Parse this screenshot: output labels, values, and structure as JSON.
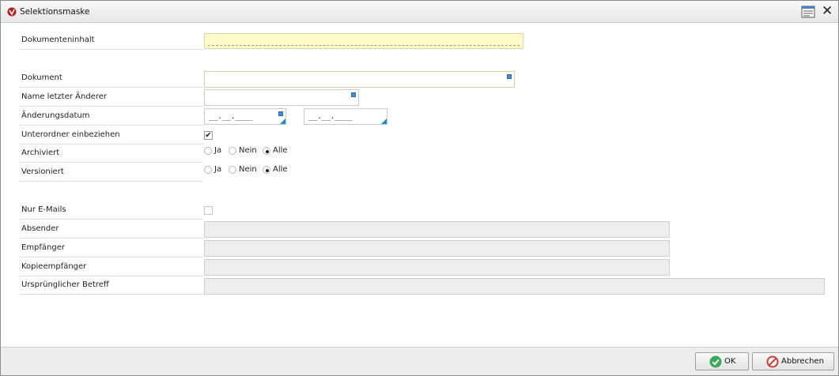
{
  "window": {
    "title": "Selektionsmaske",
    "icons": {
      "app": "app-logo-icon",
      "layout": "layout-settings-icon",
      "close": "close-icon"
    },
    "close_glyph": "✕"
  },
  "form": {
    "dokumenteninhalt": {
      "label": "Dokumenteninhalt",
      "value": ""
    },
    "dokument": {
      "label": "Dokument",
      "value": ""
    },
    "name_letzter_aenderer": {
      "label": "Name letzter Änderer",
      "value": ""
    },
    "aenderungsdatum": {
      "label": "Änderungsdatum",
      "from": "__.__.____",
      "to": "__.__.____"
    },
    "unterordner": {
      "label": "Unterordner einbeziehen",
      "checked": true,
      "check_glyph": "✔"
    },
    "archiviert": {
      "label": "Archiviert",
      "options": [
        {
          "label": "Ja"
        },
        {
          "label": "Nein"
        },
        {
          "label": "Alle"
        }
      ],
      "selected": "Alle"
    },
    "versioniert": {
      "label": "Versioniert",
      "options": [
        {
          "label": "Ja"
        },
        {
          "label": "Nein"
        },
        {
          "label": "Alle"
        }
      ],
      "selected": "Alle"
    },
    "nur_emails": {
      "label": "Nur E-Mails",
      "checked": false
    },
    "absender": {
      "label": "Absender",
      "value": ""
    },
    "empfaenger": {
      "label": "Empfänger",
      "value": ""
    },
    "kopieempfaenger": {
      "label": "Kopieempfänger",
      "value": ""
    },
    "urspruenglicher_betreff": {
      "label": "Ursprünglicher Betreff",
      "value": ""
    }
  },
  "footer": {
    "ok_label": "OK",
    "cancel_label": "Abbrechen"
  },
  "colors": {
    "highlight_field": "#fffcc9",
    "disabled_field": "#eeeeee",
    "accent_blue": "#1a8fc9",
    "ok_green": "#3bab5a",
    "cancel_red": "#d63b2f"
  }
}
